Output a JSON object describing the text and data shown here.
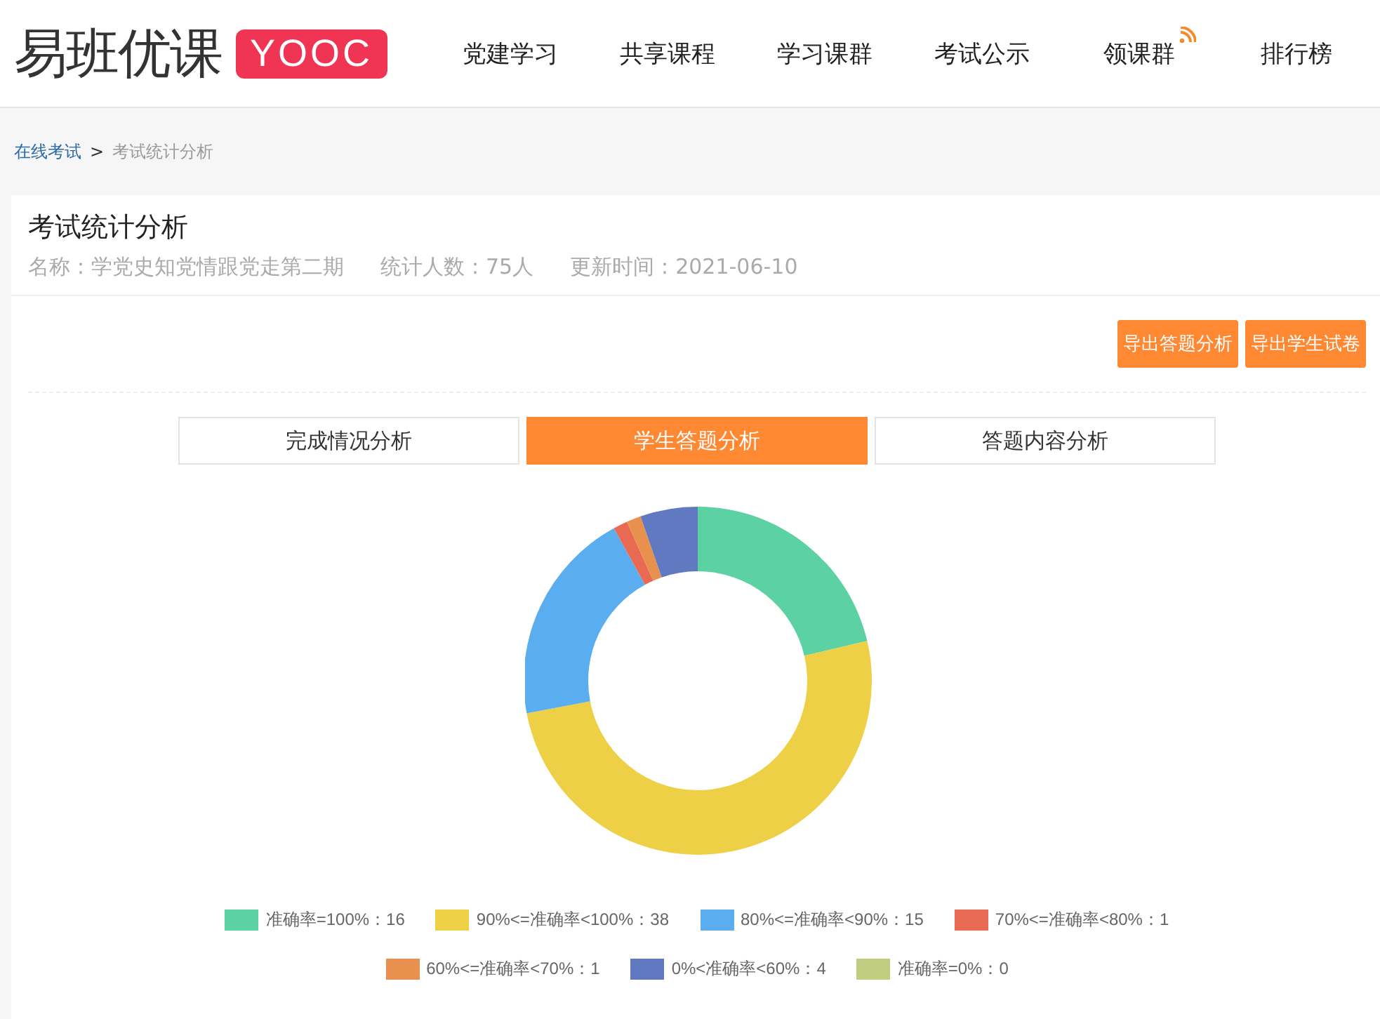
{
  "logo": {
    "name": "易班优课",
    "badge": "YOOC"
  },
  "nav": [
    {
      "label": "党建学习",
      "new": false
    },
    {
      "label": "共享课程",
      "new": false
    },
    {
      "label": "学习课群",
      "new": false
    },
    {
      "label": "考试公示",
      "new": false
    },
    {
      "label": "领课群",
      "new": true
    },
    {
      "label": "排行榜",
      "new": false
    }
  ],
  "breadcrumb": {
    "link": "在线考试",
    "separator": ">",
    "current": "考试统计分析"
  },
  "header": {
    "title": "考试统计分析",
    "meta": [
      "名称：学党史知党情跟党走第二期",
      "统计人数：75人",
      "更新时间：2021-06-10"
    ]
  },
  "buttons": [
    "导出答题分析",
    "导出学生试卷"
  ],
  "tabs": [
    {
      "label": "完成情况分析",
      "selected": false
    },
    {
      "label": "学生答题分析",
      "selected": true
    },
    {
      "label": "答题内容分析",
      "selected": false
    }
  ],
  "chart_data": {
    "type": "donut",
    "categories": [
      "准确率=100%：16",
      "90%<=准确率<100%：38",
      "80%<=准确率<90%：15",
      "70%<=准确率<80%：1",
      "60%<=准确率<70%：1",
      "0%<准确率<60%：4",
      "准确率=0%：0"
    ],
    "values": [
      16,
      38,
      15,
      1,
      1,
      4,
      0
    ]
  },
  "legend": [
    {
      "color": "#5bd1a4"
    },
    {
      "color": "#eed046"
    },
    {
      "color": "#5aaef0"
    },
    {
      "color": "#e86a52"
    },
    {
      "color": "#e8914f"
    },
    {
      "color": "#6179c0"
    },
    {
      "color": "#c0cc80"
    }
  ]
}
